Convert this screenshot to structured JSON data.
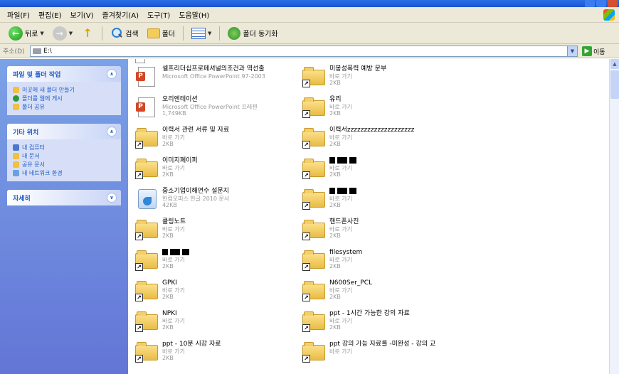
{
  "menubar": {
    "items": [
      "파일(F)",
      "편집(E)",
      "보기(V)",
      "즐겨찾기(A)",
      "도구(T)",
      "도움말(H)"
    ]
  },
  "toolbar": {
    "back_label": "뒤로",
    "search_label": "검색",
    "folders_label": "폴더",
    "sync_label": "폴더 동기화"
  },
  "address": {
    "label": "주소(D)",
    "value": "E:\\",
    "go_label": "이동"
  },
  "taskpane": {
    "file_tasks": {
      "title": "파일 및 폴더 작업",
      "items": [
        "이곳에 새 폴더 만들기",
        "폴더를 웹에 게시",
        "폴더 공유"
      ]
    },
    "other_places": {
      "title": "기타 위치",
      "items": [
        "내 컴퓨터",
        "내 문서",
        "공유 문서",
        "내 네트워크 환경"
      ]
    },
    "details": {
      "title": "자세히"
    }
  },
  "files": [
    {
      "name": "셀프리더십프로페셔널의조건과 역선출",
      "sub1": "Microsoft Office PowerPoint 97-2003",
      "sub2": "",
      "icon": "ppt-icon"
    },
    {
      "name": "미봉성폭력 예방 문부",
      "sub1": "바로 가기",
      "sub2": "2KB",
      "icon": "folder-shortcut-icon"
    },
    {
      "name": "오리엔테이션",
      "sub1": "Microsoft Office PowerPoint 프레젠",
      "sub2": "1,749KB",
      "icon": "ppt-icon"
    },
    {
      "name": "유리",
      "sub1": "바로 가기",
      "sub2": "2KB",
      "icon": "folder-shortcut-icon"
    },
    {
      "name": "이력서 관련 서류 및 자료",
      "sub1": "바로 가기",
      "sub2": "2KB",
      "icon": "folder-shortcut-icon"
    },
    {
      "name": "이력서zzzzzzzzzzzzzzzzzzzz",
      "sub1": "바로 가기",
      "sub2": "2KB",
      "icon": "folder-shortcut-icon"
    },
    {
      "name": "이미지폐이퍼",
      "sub1": "바로 가기",
      "sub2": "2KB",
      "icon": "folder-shortcut-icon"
    },
    {
      "name": "",
      "sub1": "바로 가기",
      "sub2": "2KB",
      "icon": "folder-shortcut-icon",
      "redacted": true
    },
    {
      "name": "중소기업이해연수 설문지",
      "sub1": "한컴오피스 한글 2010 문서",
      "sub2": "42KB",
      "icon": "document-icon"
    },
    {
      "name": "",
      "sub1": "바로 가기",
      "sub2": "2KB",
      "icon": "folder-shortcut-icon",
      "redacted": true
    },
    {
      "name": "클링노트",
      "sub1": "바로 가기",
      "sub2": "2KB",
      "icon": "folder-shortcut-icon"
    },
    {
      "name": "핸드폰사진",
      "sub1": "바로 가기",
      "sub2": "2KB",
      "icon": "folder-shortcut-icon"
    },
    {
      "name": "",
      "sub1": "바로 가기",
      "sub2": "2KB",
      "icon": "folder-shortcut-icon",
      "redacted": true
    },
    {
      "name": "filesystem",
      "sub1": "바로 가기",
      "sub2": "2KB",
      "icon": "folder-shortcut-icon"
    },
    {
      "name": "GPKI",
      "sub1": "바로 가기",
      "sub2": "2KB",
      "icon": "folder-shortcut-icon"
    },
    {
      "name": "N600Ser_PCL",
      "sub1": "바로 가기",
      "sub2": "2KB",
      "icon": "folder-shortcut-icon"
    },
    {
      "name": "NPKI",
      "sub1": "바로 가기",
      "sub2": "2KB",
      "icon": "folder-shortcut-icon"
    },
    {
      "name": "ppt - 1시간 가능한 강의 자료",
      "sub1": "바로 가기",
      "sub2": "2KB",
      "icon": "folder-shortcut-icon"
    },
    {
      "name": "ppt - 10분 시강 자료",
      "sub1": "바로 가기",
      "sub2": "2KB",
      "icon": "folder-shortcut-icon"
    },
    {
      "name": "ppt 강의 가능 자료를 -미완성 - 강의 교",
      "sub1": "바로 가기",
      "sub2": "",
      "icon": "folder-shortcut-icon"
    }
  ]
}
